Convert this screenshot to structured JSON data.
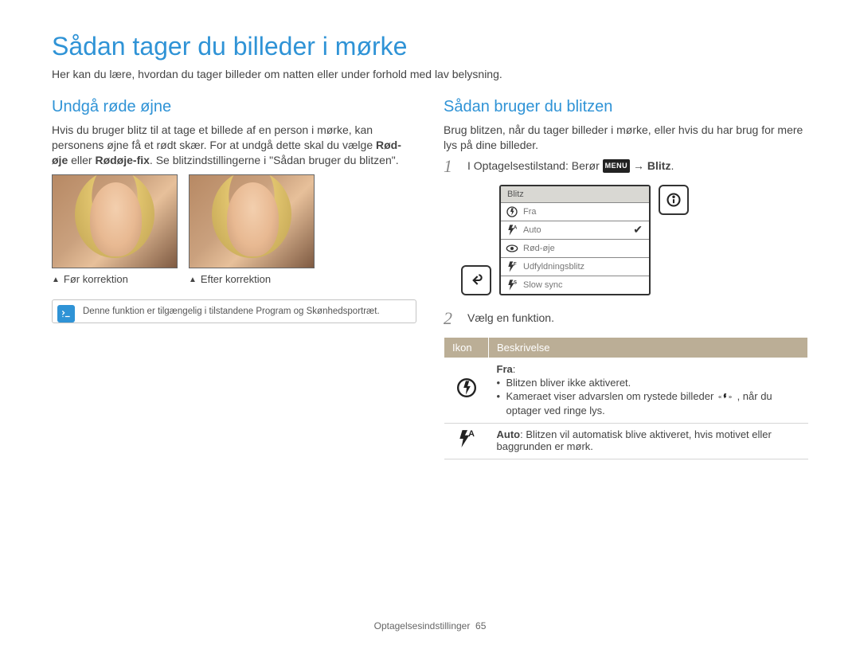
{
  "main_title": "Sådan tager du billeder i mørke",
  "intro": "Her kan du lære, hvordan du tager billeder om natten eller under forhold med lav belysning.",
  "left": {
    "heading": "Undgå røde øjne",
    "para1": "Hvis du bruger blitz til at tage et billede af en person i mørke, kan personens øjne få et rødt skær. For at undgå dette skal du vælge",
    "strong1": "Rød-øje",
    "para_mid": " eller ",
    "strong2": "Rødøje-fix",
    "para2": ". Se blitzindstillingerne i \"Sådan bruger du blitzen\".",
    "cap_before": "Før korrektion",
    "cap_after": "Efter korrektion",
    "note": "Denne funktion er tilgængelig i tilstandene Program og Skønhedsportræt."
  },
  "right": {
    "heading": "Sådan bruger du blitzen",
    "para": "Brug blitzen, når du tager billeder i mørke, eller hvis du har brug for mere lys på dine billeder.",
    "step1_prefix": "I Optagelsestilstand: Berør ",
    "step1_menu_chip": "MENU",
    "step1_arrow": " → ",
    "step1_bold": "Blitz",
    "step1_suffix": ".",
    "menu_title": "Blitz",
    "menu_items": [
      {
        "icon": "off",
        "label": "Fra"
      },
      {
        "icon": "auto",
        "label": "Auto",
        "sel": true
      },
      {
        "icon": "eye",
        "label": "Rød-øje"
      },
      {
        "icon": "fill",
        "label": "Udfyldningsblitz"
      },
      {
        "icon": "slow",
        "label": "Slow sync"
      }
    ],
    "step2": "Vælg en funktion.",
    "table": {
      "col_icon": "Ikon",
      "col_desc": "Beskrivelse",
      "row1_label": "Fra",
      "row1_b1": "Blitzen bliver ikke aktiveret.",
      "row1_b2a": "Kameraet viser advarslen om rystede billeder ",
      "row1_b2b": ", når du optager ved ringe lys.",
      "row2_label": "Auto",
      "row2_text": ": Blitzen vil automatisk blive aktiveret, hvis motivet eller baggrunden er mørk."
    }
  },
  "footer_section": "Optagelsesindstillinger",
  "footer_page": "65"
}
